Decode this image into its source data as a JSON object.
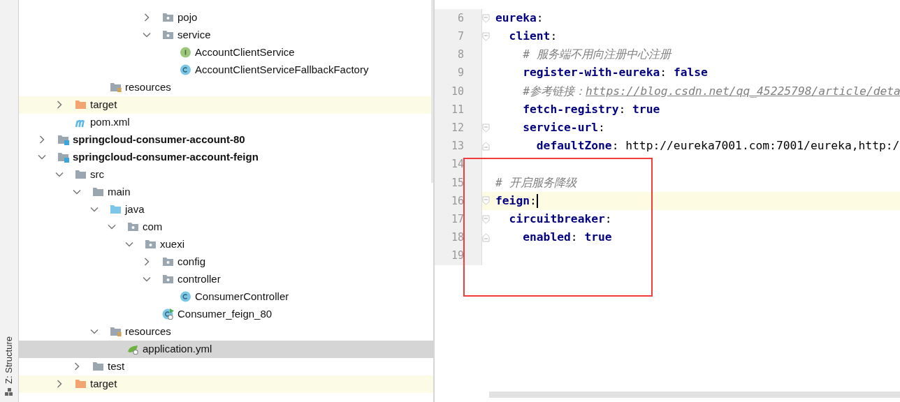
{
  "tool_strip": {
    "label": "Z: Structure"
  },
  "project_tree": [
    {
      "children": [
        {
          "children": [
            {
              "children": [
                {
                  "children": [
                    {
                      "children": [
                        {
                          "children": [
                            {
                              "label": "pojo",
                              "kind": "package",
                              "expanded": false,
                              "selected": false
                            },
                            {
                              "label": "service",
                              "kind": "package",
                              "expanded": true,
                              "selected": false,
                              "children": [
                                {
                                  "label": "AccountClientService",
                                  "kind": "interface",
                                  "selected": false
                                },
                                {
                                  "label": "AccountClientServiceFallbackFactory",
                                  "kind": "class",
                                  "selected": false
                                }
                              ]
                            }
                          ]
                        }
                      ]
                    }
                  ]
                },
                {
                  "label": "resources",
                  "kind": "resources-folder",
                  "selected": false
                }
              ]
            }
          ]
        },
        {
          "label": "target",
          "kind": "excluded-folder",
          "expanded": false,
          "selected": false
        },
        {
          "label": "pom.xml",
          "kind": "maven",
          "selected": false
        }
      ]
    },
    {
      "label": "springcloud-consumer-account-80",
      "kind": "module",
      "expanded": false,
      "selected": false
    },
    {
      "label": "springcloud-consumer-account-feign",
      "kind": "module",
      "expanded": true,
      "selected": false,
      "children": [
        {
          "label": "src",
          "kind": "folder",
          "expanded": true,
          "selected": false,
          "children": [
            {
              "label": "main",
              "kind": "folder",
              "expanded": true,
              "selected": false,
              "children": [
                {
                  "label": "java",
                  "kind": "source-folder",
                  "expanded": true,
                  "selected": false,
                  "children": [
                    {
                      "label": "com",
                      "kind": "package",
                      "expanded": true,
                      "selected": false,
                      "children": [
                        {
                          "label": "xuexi",
                          "kind": "package",
                          "expanded": true,
                          "selected": false,
                          "children": [
                            {
                              "label": "config",
                              "kind": "package",
                              "expanded": false,
                              "selected": false
                            },
                            {
                              "label": "controller",
                              "kind": "package",
                              "expanded": true,
                              "selected": false,
                              "children": [
                                {
                                  "label": "ConsumerController",
                                  "kind": "class",
                                  "selected": false
                                }
                              ]
                            },
                            {
                              "label": "Consumer_feign_80",
                              "kind": "spring-boot-class",
                              "selected": false
                            }
                          ]
                        }
                      ]
                    }
                  ]
                },
                {
                  "label": "resources",
                  "kind": "resources-folder",
                  "expanded": true,
                  "selected": false,
                  "children": [
                    {
                      "label": "application.yml",
                      "kind": "spring-config",
                      "selected": true
                    }
                  ]
                }
              ]
            },
            {
              "label": "test",
              "kind": "folder",
              "expanded": false,
              "selected": false
            }
          ]
        },
        {
          "label": "target",
          "kind": "excluded-folder",
          "expanded": false,
          "selected": false
        }
      ]
    }
  ],
  "editor": {
    "lines": [
      {
        "number": "6",
        "current": false,
        "fold": {
          "kind": "start"
        },
        "tokens": [
          {
            "text": "eureka",
            "kind": "key"
          },
          {
            "text": ":",
            "kind": "punct"
          }
        ]
      },
      {
        "number": "7",
        "current": false,
        "fold": {
          "kind": "start"
        },
        "tokens": [
          {
            "text": "  client",
            "kind": "key"
          },
          {
            "text": ":",
            "kind": "punct"
          }
        ]
      },
      {
        "number": "8",
        "current": false,
        "tokens": [
          {
            "text": "    # 服务端不用向注册中心注册",
            "kind": "comment"
          }
        ]
      },
      {
        "number": "9",
        "current": false,
        "tokens": [
          {
            "text": "    register-with-eureka",
            "kind": "key"
          },
          {
            "text": ": ",
            "kind": "punct"
          },
          {
            "text": "false",
            "kind": "bool"
          }
        ]
      },
      {
        "number": "10",
        "current": false,
        "tokens": [
          {
            "text": "    #参考链接：",
            "kind": "comment"
          },
          {
            "text": "https://blog.csdn.net/qq_45225798/article/deta",
            "kind": "link"
          }
        ]
      },
      {
        "number": "11",
        "current": false,
        "tokens": [
          {
            "text": "    fetch-registry",
            "kind": "key"
          },
          {
            "text": ": ",
            "kind": "punct"
          },
          {
            "text": "true",
            "kind": "bool"
          }
        ]
      },
      {
        "number": "12",
        "current": false,
        "fold": {
          "kind": "start"
        },
        "tokens": [
          {
            "text": "    service-url",
            "kind": "key"
          },
          {
            "text": ":",
            "kind": "punct"
          }
        ]
      },
      {
        "number": "13",
        "current": false,
        "fold": {
          "kind": "end"
        },
        "tokens": [
          {
            "text": "      defaultZone",
            "kind": "key"
          },
          {
            "text": ": ",
            "kind": "punct"
          },
          {
            "text": "http://eureka7001.com:7001/eureka,http:/",
            "kind": "plain"
          }
        ]
      },
      {
        "number": "14",
        "current": false
      },
      {
        "number": "15",
        "current": false,
        "tokens": [
          {
            "text": "# 开启服务降级",
            "kind": "comment"
          }
        ]
      },
      {
        "number": "16",
        "current": true,
        "fold": {
          "kind": "start"
        },
        "tokens": [
          {
            "text": "feign",
            "kind": "key"
          },
          {
            "text": ":",
            "kind": "punct"
          }
        ]
      },
      {
        "number": "17",
        "current": false,
        "fold": {
          "kind": "start"
        },
        "tokens": [
          {
            "text": "  circuitbreaker",
            "kind": "key"
          },
          {
            "text": ":",
            "kind": "punct"
          }
        ]
      },
      {
        "number": "18",
        "current": false,
        "fold": {
          "kind": "end"
        },
        "tokens": [
          {
            "text": "    enabled",
            "kind": "key"
          },
          {
            "text": ": ",
            "kind": "punct"
          },
          {
            "text": "true",
            "kind": "bool"
          }
        ]
      },
      {
        "number": "19",
        "current": false
      }
    ]
  }
}
